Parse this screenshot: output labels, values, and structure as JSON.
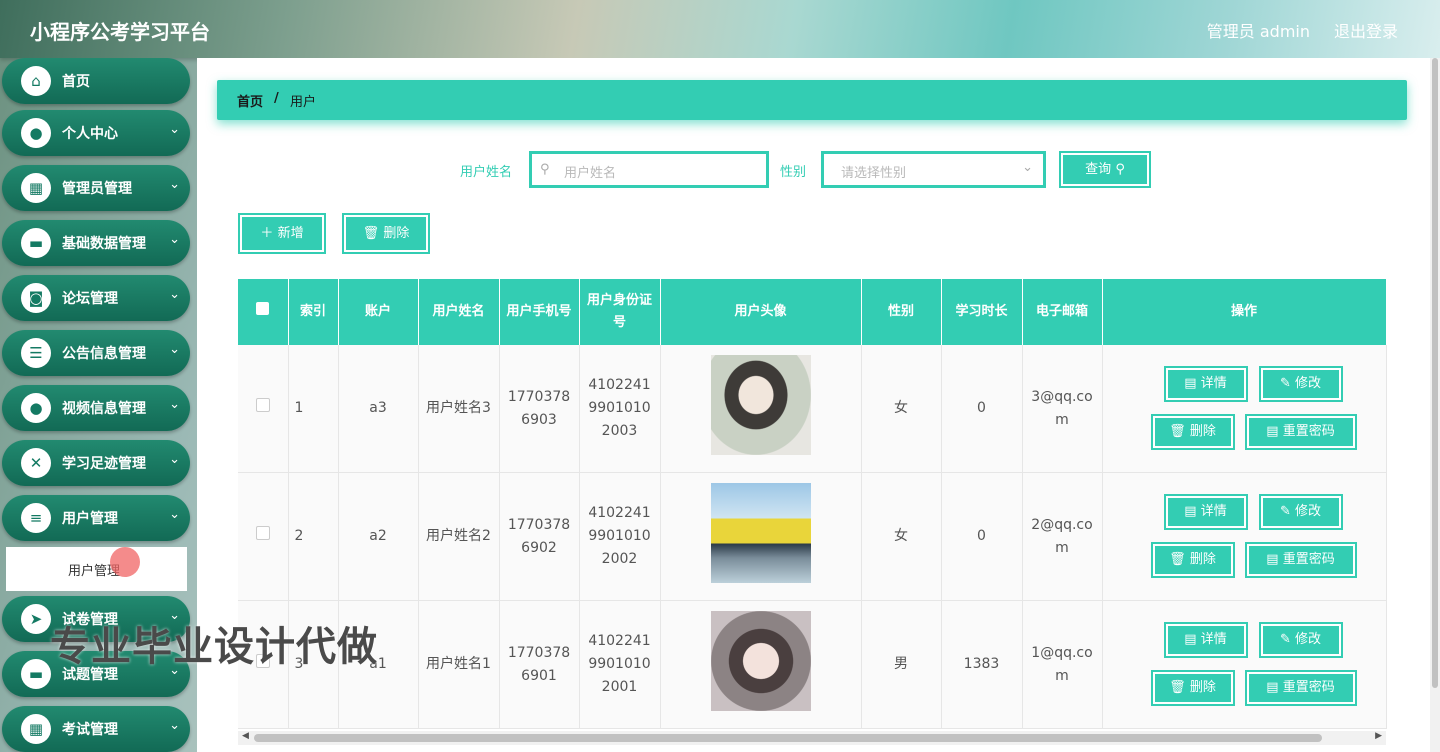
{
  "header": {
    "app_title": "小程序公考学习平台",
    "admin_label": "管理员 admin",
    "logout": "退出登录"
  },
  "sidebar": {
    "items": [
      {
        "label": "首页",
        "icon": "home-icon",
        "glyph": "⌂",
        "chev": ""
      },
      {
        "label": "个人中心",
        "icon": "user-icon",
        "glyph": "●",
        "chev": "⌄"
      },
      {
        "label": "管理员管理",
        "icon": "grid-icon",
        "glyph": "▦",
        "chev": "⌄"
      },
      {
        "label": "基础数据管理",
        "icon": "briefcase-icon",
        "glyph": "▬",
        "chev": "⌄"
      },
      {
        "label": "论坛管理",
        "icon": "wallet-icon",
        "glyph": "◙",
        "chev": "⌄"
      },
      {
        "label": "公告信息管理",
        "icon": "document-icon",
        "glyph": "☰",
        "chev": "⌄"
      },
      {
        "label": "视频信息管理",
        "icon": "bulb-icon",
        "glyph": "●",
        "chev": "⌄"
      },
      {
        "label": "学习足迹管理",
        "icon": "clipboard-icon",
        "glyph": "✕",
        "chev": "⌄"
      },
      {
        "label": "用户管理",
        "icon": "sliders-icon",
        "glyph": "≡",
        "chev": "⌄"
      },
      {
        "label": "试卷管理",
        "icon": "send-icon",
        "glyph": "➤",
        "chev": "⌄"
      },
      {
        "label": "试题管理",
        "icon": "ticket-icon",
        "glyph": "▬",
        "chev": "⌄"
      },
      {
        "label": "考试管理",
        "icon": "grid-icon",
        "glyph": "▦",
        "chev": "⌄"
      }
    ],
    "submenu_label": "用户管理"
  },
  "breadcrumb": {
    "home": "首页",
    "sep": "/",
    "current": "用户"
  },
  "search": {
    "name_label": "用户姓名",
    "name_placeholder": "用户姓名",
    "gender_label": "性别",
    "gender_placeholder": "请选择性别",
    "query_button": "查询"
  },
  "actions": {
    "add": "新增",
    "delete": "删除"
  },
  "table": {
    "headers": [
      "索引",
      "账户",
      "用户姓名",
      "用户手机号",
      "用户身份证号",
      "用户头像",
      "性别",
      "学习时长",
      "电子邮箱",
      "操作"
    ],
    "rows": [
      {
        "index": "1",
        "account": "a3",
        "name": "用户姓名3",
        "phone": "17703786903",
        "id_card": "410224199010102003",
        "gender": "女",
        "study_time": "0",
        "email": "3@qq.com"
      },
      {
        "index": "2",
        "account": "a2",
        "name": "用户姓名2",
        "phone": "17703786902",
        "id_card": "410224199010102002",
        "gender": "女",
        "study_time": "0",
        "email": "2@qq.com"
      },
      {
        "index": "3",
        "account": "a1",
        "name": "用户姓名1",
        "phone": "17703786901",
        "id_card": "410224199010102001",
        "gender": "男",
        "study_time": "1383",
        "email": "1@qq.com"
      }
    ],
    "op_labels": {
      "detail": "详情",
      "edit": "修改",
      "delete": "删除",
      "reset": "重置密码"
    }
  },
  "watermark": "专业毕业设计代做",
  "colors": {
    "accent": "#33cdb3",
    "sidebar": "#1a7d66"
  }
}
